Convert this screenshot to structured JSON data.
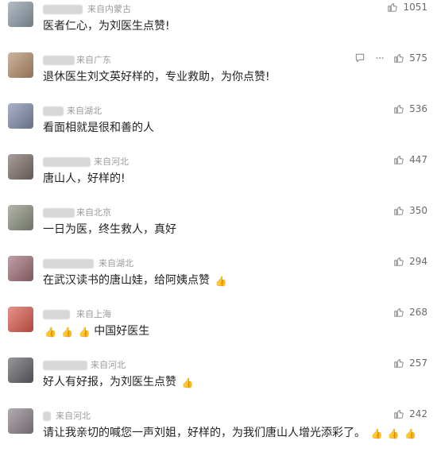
{
  "comments": [
    {
      "location": "来自内蒙古",
      "text": "医者仁心，为刘医生点赞!",
      "likes": "1051",
      "avatar_color": "#8d9aa7"
    },
    {
      "location": "来自广东",
      "text": "退休医生刘文英好样的，专业救助，为你点赞!",
      "likes": "575",
      "avatar_color": "#b38d69"
    },
    {
      "location": "来自湖北",
      "text": "看面相就是很和善的人",
      "likes": "536",
      "avatar_color": "#7d8aa8"
    },
    {
      "location": "来自河北",
      "text": "唐山人，好样的!",
      "likes": "447",
      "avatar_color": "#7b6b67"
    },
    {
      "location": "来自北京",
      "text": "一日为医，终生救人，真好",
      "likes": "350",
      "avatar_color": "#8a8e7f"
    },
    {
      "location": "来自湖北",
      "text": "在武汉读书的唐山娃，给阿姨点赞",
      "likes": "294",
      "avatar_color": "#9f6c76"
    },
    {
      "location": "来自上海",
      "text": "中国好医生",
      "likes": "268",
      "avatar_color": "#d9584a"
    },
    {
      "location": "来自河北",
      "text": "好人有好报，为刘医生点赞",
      "likes": "257",
      "avatar_color": "#5f5f66"
    },
    {
      "location": "来自河北",
      "text": "请让我亲切的喊您一声刘姐，好样的，为我们唐山人增光添彩了。",
      "likes": "242",
      "avatar_color": "#8a8088"
    }
  ],
  "icons": {
    "like": "thumbs-up-icon",
    "reply": "comment-icon",
    "more": "more-icon",
    "emoji": "thumbs-up-emoji-icon"
  }
}
